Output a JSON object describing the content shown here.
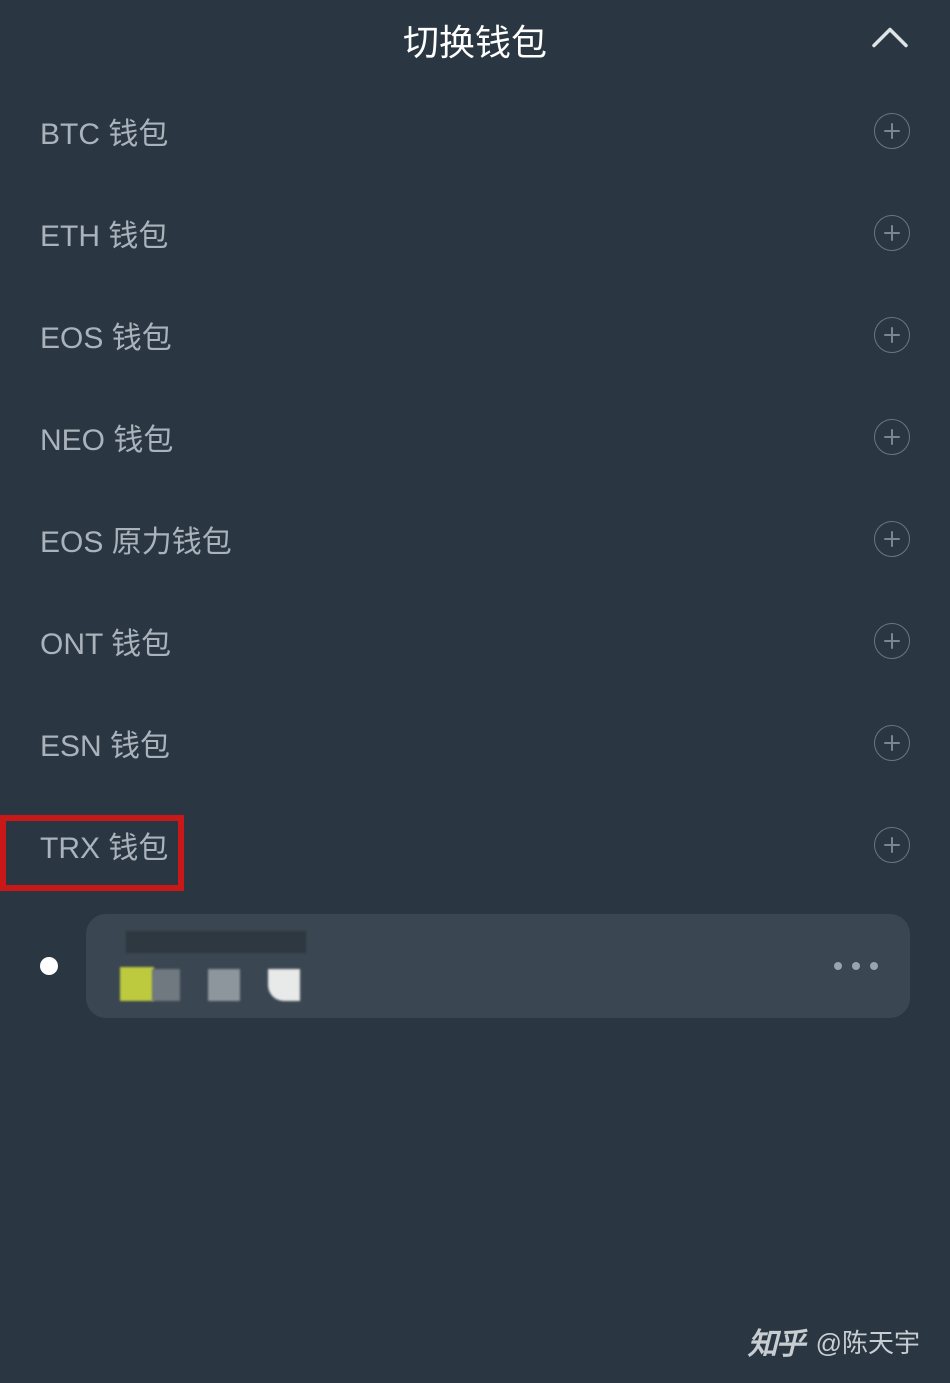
{
  "header": {
    "title": "切换钱包"
  },
  "wallets": [
    {
      "label": "BTC 钱包"
    },
    {
      "label": "ETH 钱包"
    },
    {
      "label": "EOS 钱包"
    },
    {
      "label": "NEO 钱包"
    },
    {
      "label": "EOS 原力钱包"
    },
    {
      "label": "ONT 钱包"
    },
    {
      "label": "ESN 钱包"
    },
    {
      "label": "TRX 钱包"
    }
  ],
  "watermark": {
    "site": "知乎",
    "user": "@陈天宇"
  },
  "colors": {
    "background": "#2a3641",
    "text": "#aab3bc",
    "highlight": "#c91818",
    "card": "#3a4651"
  }
}
